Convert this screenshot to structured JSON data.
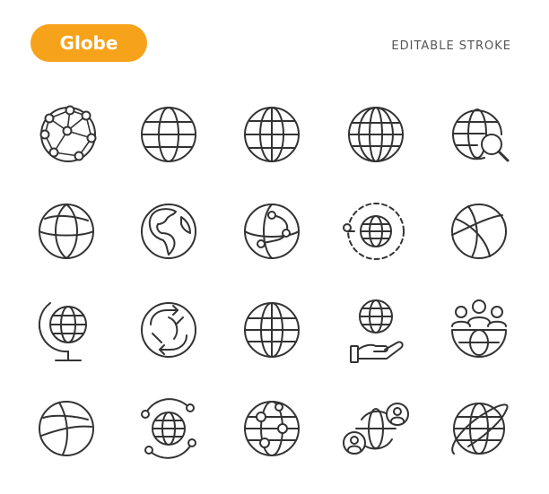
{
  "header": {
    "title": "Globe",
    "tagline": "EDITABLE STROKE",
    "badge_color": "#f7a21b"
  },
  "icons": [
    {
      "name": "network-globe-icon"
    },
    {
      "name": "globe-icon"
    },
    {
      "name": "globe-grid-icon"
    },
    {
      "name": "globe-wireframe-icon"
    },
    {
      "name": "globe-search-icon"
    },
    {
      "name": "globe-tilted-icon"
    },
    {
      "name": "earth-americas-icon"
    },
    {
      "name": "globe-route-icon"
    },
    {
      "name": "globe-orbit-icon"
    },
    {
      "name": "globe-curves-icon"
    },
    {
      "name": "desk-globe-icon"
    },
    {
      "name": "globe-exchange-icon"
    },
    {
      "name": "globe-latitude-icon"
    },
    {
      "name": "globe-hand-icon"
    },
    {
      "name": "globe-community-icon"
    },
    {
      "name": "globe-lines-icon"
    },
    {
      "name": "globe-connected-icon"
    },
    {
      "name": "globe-locations-icon"
    },
    {
      "name": "globe-users-icon"
    },
    {
      "name": "globe-ring-icon"
    }
  ],
  "stroke_color": "#333333"
}
